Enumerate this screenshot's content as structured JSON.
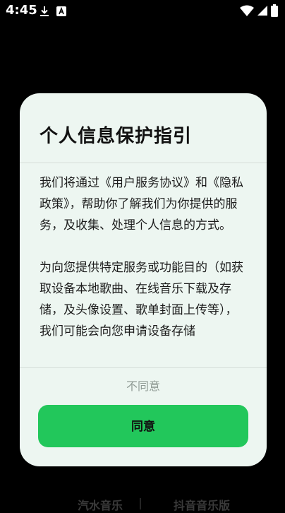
{
  "status_bar": {
    "time": "4:45",
    "icons": [
      "download-icon",
      "a-letter-icon",
      "wifi-icon",
      "signal-icon",
      "battery-icon"
    ]
  },
  "dialog": {
    "title": "个人信息保护指引",
    "paragraphs": [
      "我们将通过《用户服务协议》和《隐私政策》，帮助你了解我们为你提供的服务，及收集、处理个人信息的方式。",
      "为向您提供特定服务或功能目的（如获取设备本地歌曲、在线音乐下载及存储，及头像设置、歌单封面上传等），我们可能会向您申请设备存储"
    ],
    "disagree_label": "不同意",
    "agree_label": "同意"
  },
  "footer": {
    "left": "汽水音乐",
    "separator": "|",
    "right": "抖音音乐版"
  },
  "colors": {
    "accent": "#22C75B",
    "dialog_bg": "#EDF6F1",
    "background": "#000000"
  }
}
